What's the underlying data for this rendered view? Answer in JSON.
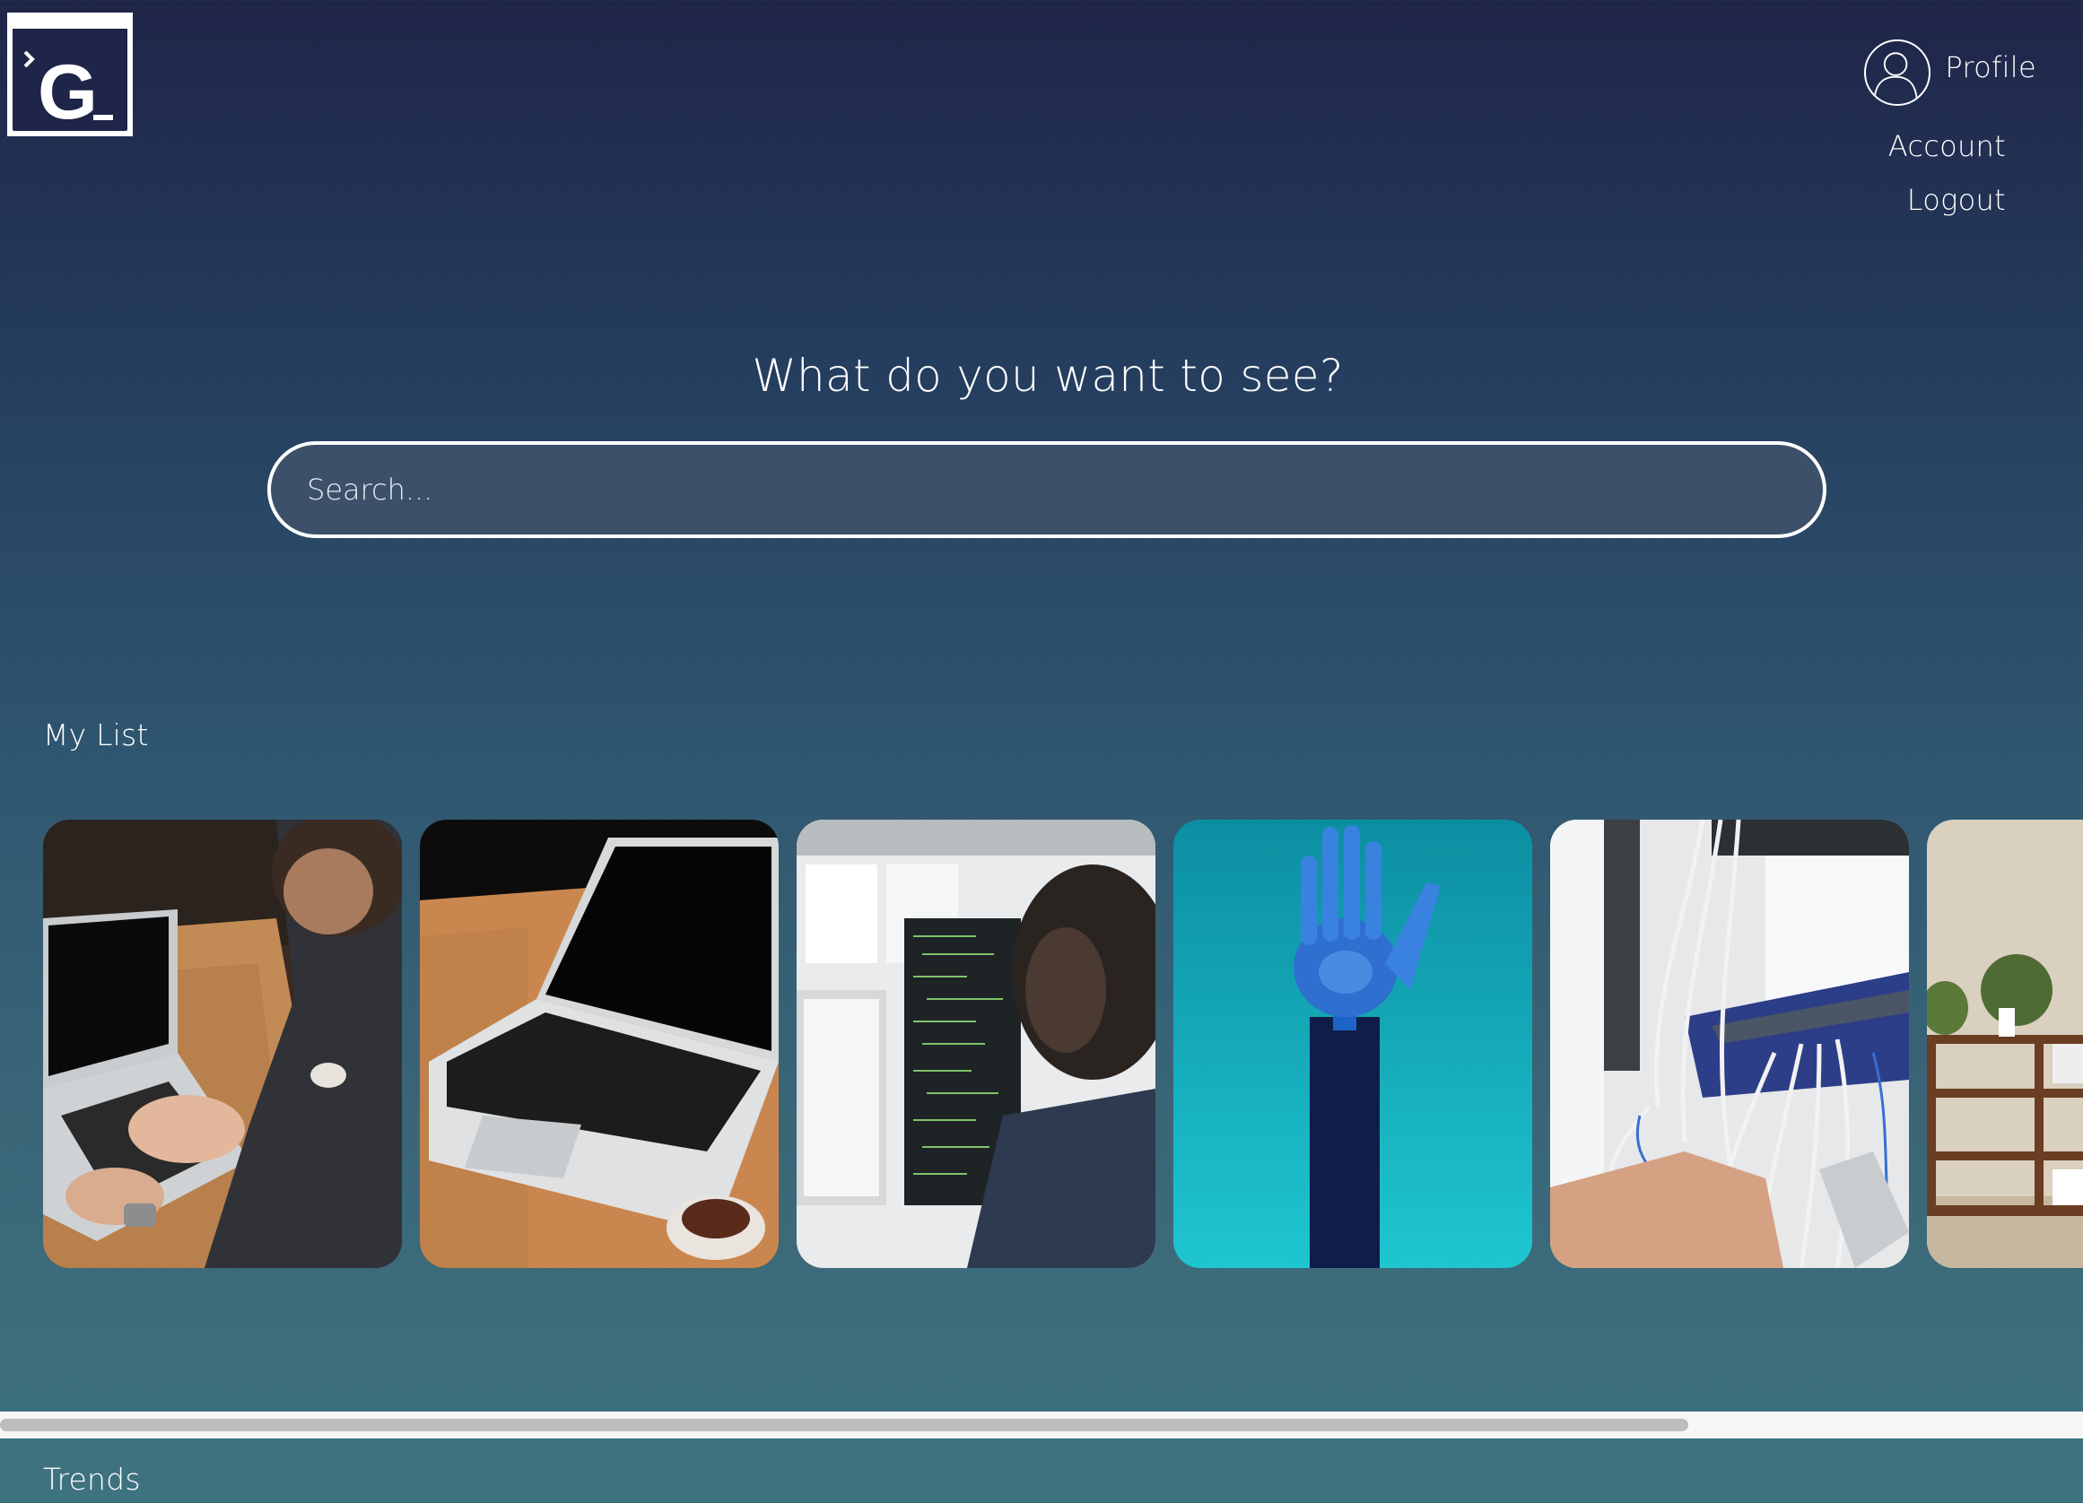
{
  "header": {
    "logo_icon": "terminal-g-logo",
    "profile": {
      "label": "Profile",
      "icon": "user-avatar-icon"
    },
    "menu": [
      {
        "label": "Account"
      },
      {
        "label": "Logout"
      }
    ]
  },
  "hero": {
    "title": "What do you want to see?",
    "search": {
      "placeholder": "Search...",
      "value": ""
    }
  },
  "my_list": {
    "title": "My List",
    "cards": [
      {
        "name": "laptop-typing-card"
      },
      {
        "name": "laptop-coffee-card"
      },
      {
        "name": "developer-monitors-card"
      },
      {
        "name": "robot-hand-card"
      },
      {
        "name": "network-cables-card"
      },
      {
        "name": "room-shelves-card"
      }
    ]
  },
  "trends": {
    "title": "Trends"
  },
  "colors": {
    "bg_top": "#1f2548",
    "bg_bottom": "#3e7380",
    "search_bg": "#3d5069",
    "scroll_thumb": "#bdbdbd"
  }
}
